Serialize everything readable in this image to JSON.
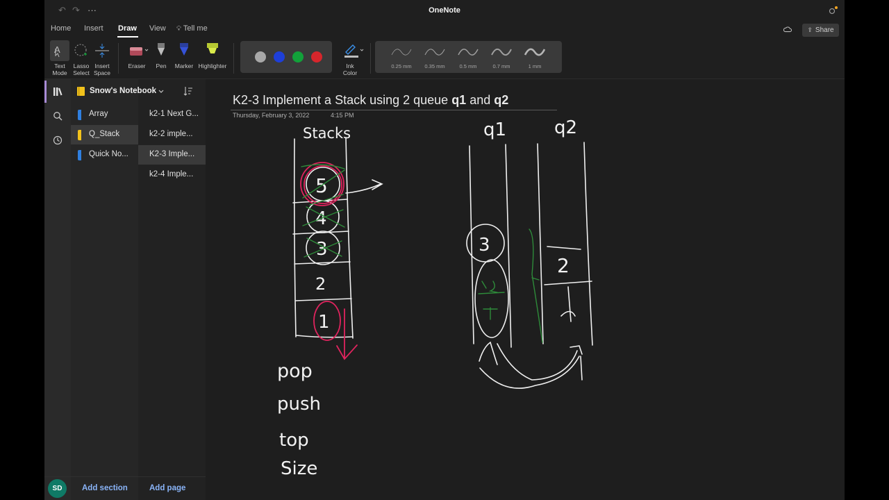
{
  "window": {
    "title": "OneNote",
    "share_label": "Share"
  },
  "ribbon": {
    "tabs": [
      "Home",
      "Insert",
      "Draw",
      "View",
      "Tell me"
    ],
    "active_tab": "Draw"
  },
  "toolbar": {
    "tools": [
      {
        "label1": "Text",
        "label2": "Mode"
      },
      {
        "label1": "Lasso",
        "label2": "Select"
      },
      {
        "label1": "Insert",
        "label2": "Space"
      }
    ],
    "pens": [
      {
        "label": "Eraser"
      },
      {
        "label": "Pen"
      },
      {
        "label": "Marker"
      },
      {
        "label": "Highlighter"
      }
    ],
    "colors": [
      "#a8a8a8",
      "#1e3fd8",
      "#12a13a",
      "#d6262c"
    ],
    "ink_color": {
      "label1": "Ink",
      "label2": "Color"
    },
    "widths": [
      "0.25 mm",
      "0.35 mm",
      "0.5 mm",
      "0.7 mm",
      "1 mm"
    ]
  },
  "notebook": {
    "name": "Snow's Notebook"
  },
  "sections": [
    {
      "label": "Array",
      "color": "#2f7fe0"
    },
    {
      "label": "Q_Stack",
      "color": "#f2c21b"
    },
    {
      "label": "Quick No...",
      "color": "#2f7fe0"
    }
  ],
  "pages": [
    {
      "label": "k2-1 Next G..."
    },
    {
      "label": "k2-2 imple..."
    },
    {
      "label": "K2-3 Imple..."
    },
    {
      "label": "k2-4 Imple..."
    }
  ],
  "footer": {
    "avatar": "SD",
    "add_section": "Add section",
    "add_page": "Add page"
  },
  "page": {
    "title_part1": "K2-3 Implement a Stack using 2 queue ",
    "title_q1": "q1",
    "title_and": " and ",
    "title_q2": "q2",
    "date": "Thursday, February 3, 2022",
    "time": "4:15 PM"
  },
  "ink": {
    "stack_label": "Stacks",
    "q1_label": "q1",
    "q2_label": "q2",
    "stack_items": [
      "5",
      "4",
      "3",
      "2",
      "1"
    ],
    "q1_items": [
      "3"
    ],
    "q2_items": [
      "2"
    ],
    "ops": [
      "pop",
      "push",
      "top",
      "Size"
    ]
  }
}
